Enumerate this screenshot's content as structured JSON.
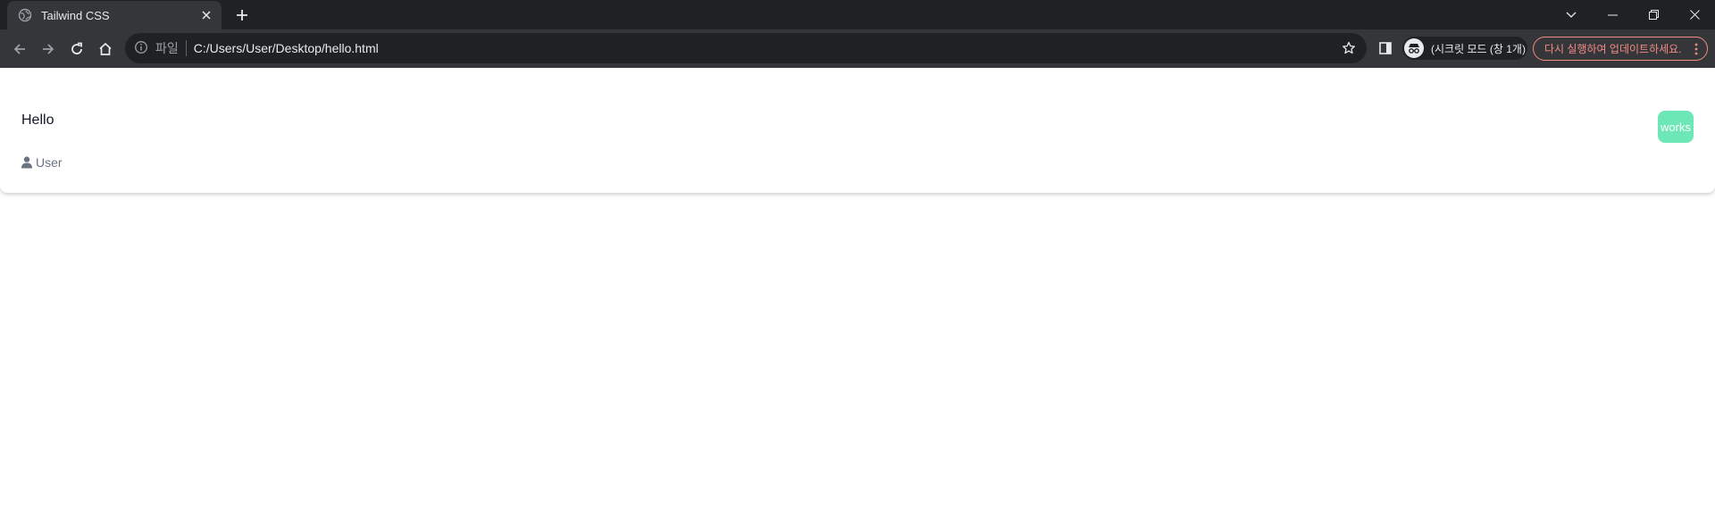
{
  "browser": {
    "tab": {
      "title": "Tailwind CSS"
    },
    "address_bar": {
      "scheme_label": "파일",
      "url": "C:/Users/User/Desktop/hello.html"
    },
    "profile": {
      "label": "(시크릿 모드 (창 1개)"
    },
    "update_button": {
      "label": "다시 실행하여 업데이트하세요."
    }
  },
  "page": {
    "card": {
      "title": "Hello",
      "user_label": "User",
      "badge_label": "works"
    }
  },
  "colors": {
    "badge_bg": "#6ee7b7",
    "chrome_dark": "#202124",
    "chrome_toolbar": "#35363a",
    "update_accent": "#f28b82"
  },
  "icons": {
    "tab_favicon": "globe-icon",
    "tab_close": "close-icon",
    "new_tab": "plus-icon",
    "back": "arrow-left-icon",
    "forward": "arrow-right-icon",
    "reload": "reload-icon",
    "home": "home-icon",
    "site_info": "info-icon",
    "bookmark": "star-icon",
    "side_panel": "side-panel-icon",
    "profile": "incognito-icon",
    "menu": "kebab-menu-icon",
    "user": "user-icon"
  }
}
